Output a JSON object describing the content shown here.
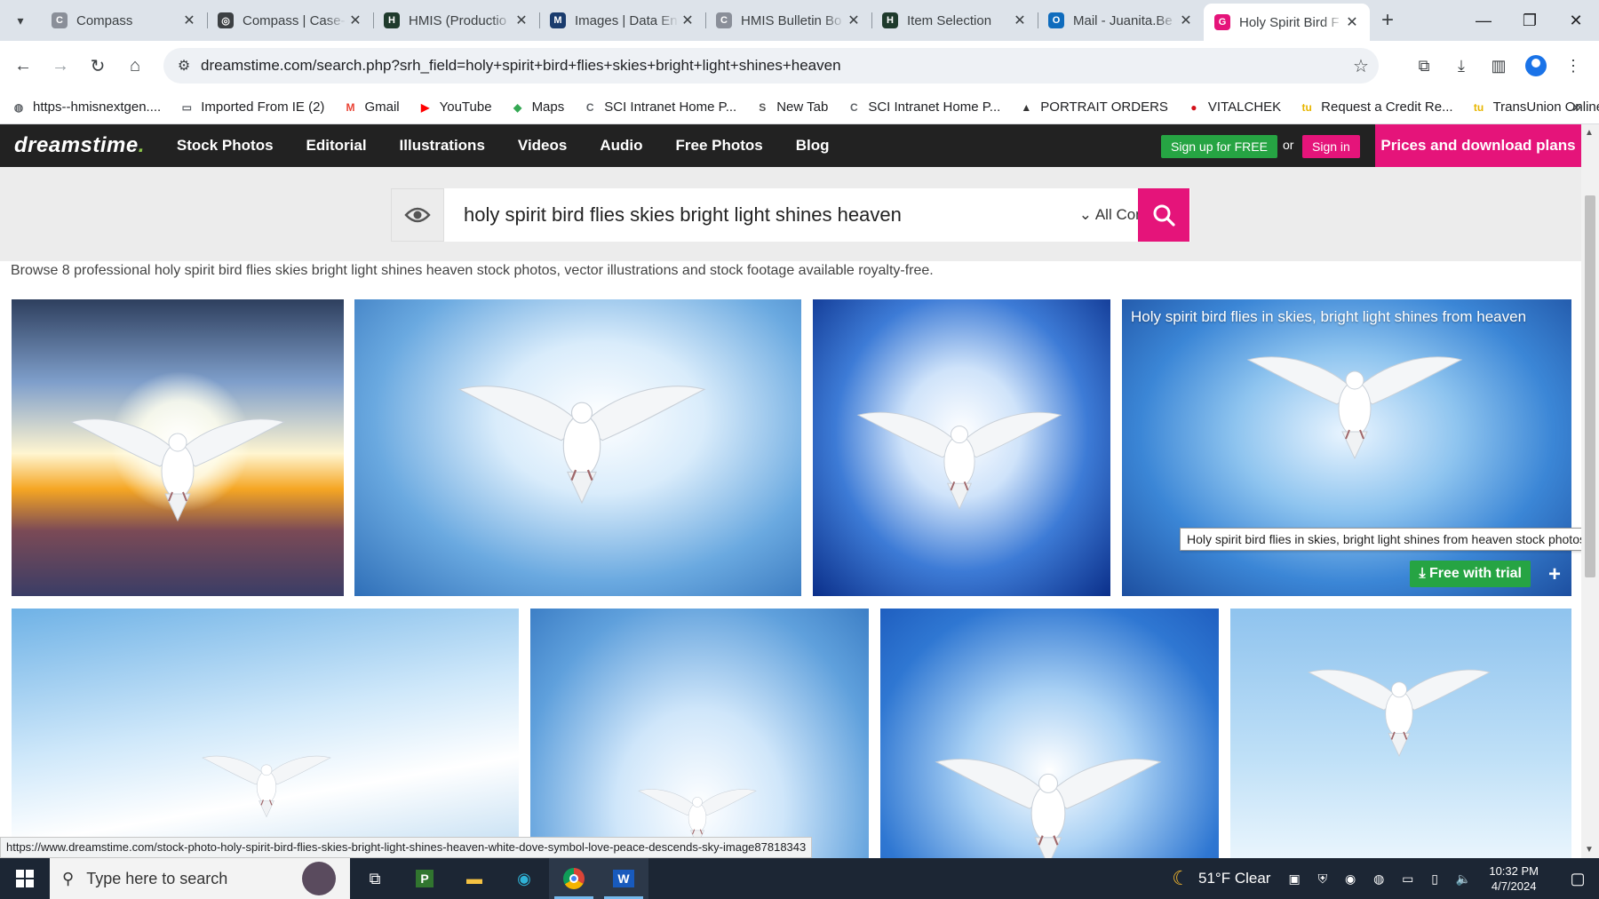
{
  "browser": {
    "tabs": [
      {
        "title": "Compass",
        "favicon_color": "#8a8f99",
        "glyph": "C"
      },
      {
        "title": "Compass | Case-",
        "favicon_color": "#3c4043",
        "glyph": "◎"
      },
      {
        "title": "HMIS (Productio",
        "favicon_color": "#1f3b2d",
        "glyph": "H"
      },
      {
        "title": "Images | Data En",
        "favicon_color": "#1a3c6e",
        "glyph": "M"
      },
      {
        "title": "HMIS Bulletin Bo",
        "favicon_color": "#8a8f99",
        "glyph": "C"
      },
      {
        "title": "Item Selection",
        "favicon_color": "#1f3b2d",
        "glyph": "H"
      },
      {
        "title": "Mail - Juanita.Be",
        "favicon_color": "#0f6cbd",
        "glyph": "O"
      },
      {
        "title": "Holy Spirit Bird F",
        "favicon_color": "#e5147a",
        "glyph": "G",
        "active": true
      }
    ],
    "url": "dreamstime.com/search.php?srh_field=holy+spirit+bird+flies+skies+bright+light+shines+heaven",
    "bookmarks": [
      {
        "label": "https--hmisnextgen....",
        "icon_color": "#5f6368",
        "glyph": "◍"
      },
      {
        "label": "Imported From IE (2)",
        "icon_color": "#5f6368",
        "glyph": "▭"
      },
      {
        "label": "Gmail",
        "icon_color": "#ea4335",
        "glyph": "M"
      },
      {
        "label": "YouTube",
        "icon_color": "#ff0000",
        "glyph": "▶"
      },
      {
        "label": "Maps",
        "icon_color": "#34a853",
        "glyph": "◆"
      },
      {
        "label": "SCI Intranet Home P...",
        "icon_color": "#5f6368",
        "glyph": "C"
      },
      {
        "label": "New Tab",
        "icon_color": "#555",
        "glyph": "S"
      },
      {
        "label": "SCI Intranet Home P...",
        "icon_color": "#5f6368",
        "glyph": "C"
      },
      {
        "label": "PORTRAIT ORDERS",
        "icon_color": "#333",
        "glyph": "▲"
      },
      {
        "label": "VITALCHEK",
        "icon_color": "#d3111a",
        "glyph": "●"
      },
      {
        "label": "Request a Credit Re...",
        "icon_color": "#e8b600",
        "glyph": "tu"
      },
      {
        "label": "TransUnion Online S...",
        "icon_color": "#e8b600",
        "glyph": "tu"
      }
    ]
  },
  "site": {
    "logo_main": "dreamstime",
    "logo_suffix": ".",
    "nav": [
      "Stock Photos",
      "Editorial",
      "Illustrations",
      "Videos",
      "Audio",
      "Free Photos",
      "Blog"
    ],
    "signup_label": "Sign up for FREE",
    "or_label": "or",
    "signin_label": "Sign in",
    "prices_label": "Prices and download plans",
    "search_query": "holy spirit bird flies skies bright light shines heaven",
    "content_filter": "All Content",
    "browse_text": "Browse 8 professional holy spirit bird flies skies bright light shines heaven stock photos, vector illustrations and stock footage available royalty-free.",
    "hover_caption": "Holy spirit bird flies in skies, bright light shines from heaven",
    "tooltip": "Holy spirit bird flies in skies, bright light shines from heaven stock photos",
    "free_trial_label": "Free with trial",
    "plus_label": "+",
    "accent": "#e5147a",
    "green": "#26a443"
  },
  "status_url": "https://www.dreamstime.com/stock-photo-holy-spirit-bird-flies-skies-bright-light-shines-heaven-white-dove-symbol-love-peace-descends-sky-image87818343",
  "taskbar": {
    "search_placeholder": "Type here to search",
    "weather": "51°F  Clear",
    "time": "10:32 PM",
    "date": "4/7/2024"
  }
}
